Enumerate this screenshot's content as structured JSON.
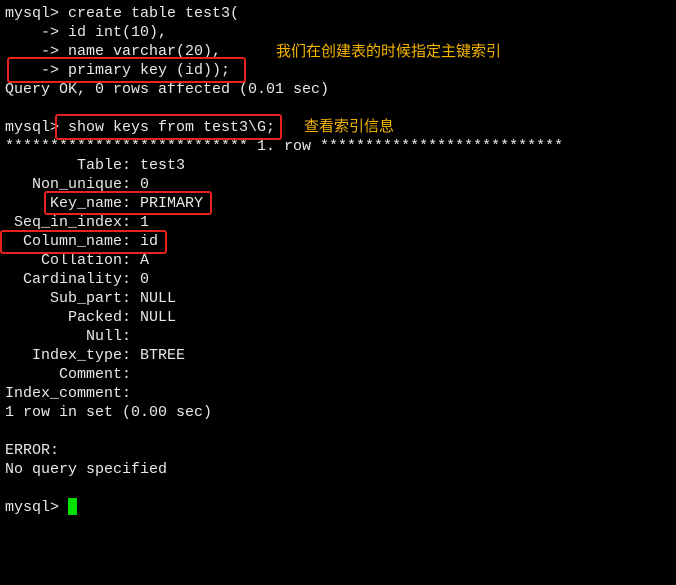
{
  "terminal": {
    "lines": [
      "mysql> create table test3(",
      "    -> id int(10),",
      "    -> name varchar(20),",
      "    -> primary key (id));",
      "Query OK, 0 rows affected (0.01 sec)",
      "",
      "mysql> show keys from test3\\G;",
      "*************************** 1. row ***************************",
      "        Table: test3",
      "   Non_unique: 0",
      "     Key_name: PRIMARY",
      " Seq_in_index: 1",
      "  Column_name: id",
      "    Collation: A",
      "  Cardinality: 0",
      "     Sub_part: NULL",
      "       Packed: NULL",
      "         Null: ",
      "   Index_type: BTREE",
      "      Comment: ",
      "Index_comment: ",
      "1 row in set (0.00 sec)",
      "",
      "ERROR:",
      "No query specified",
      "",
      "mysql> "
    ],
    "cursor_color": "#00e000"
  },
  "annotations": {
    "primary_key_note": "我们在创建表的时候指定主键索引",
    "show_keys_note": "查看索引信息",
    "highlight_color": "#e8231d",
    "note_color": "#f5b400"
  }
}
